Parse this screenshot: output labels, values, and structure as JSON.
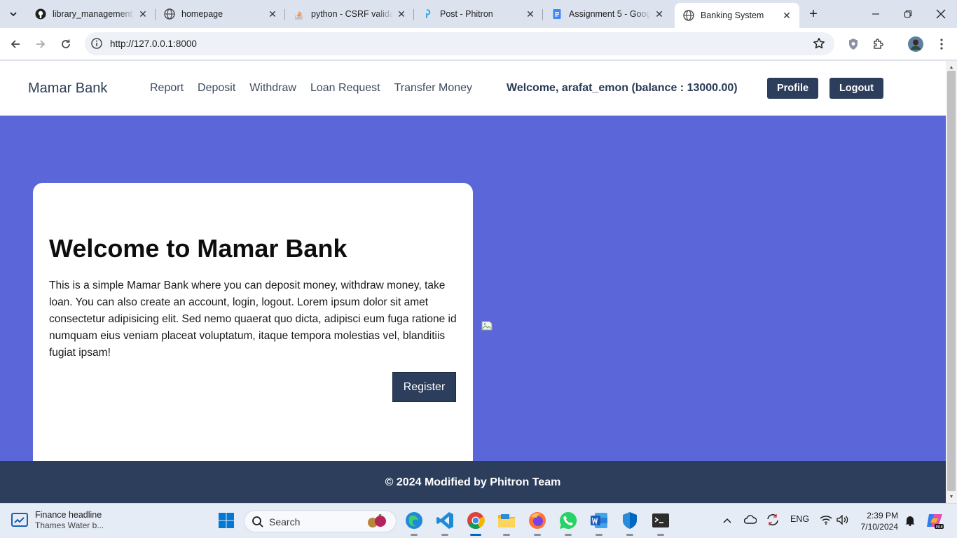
{
  "browser": {
    "tabs": [
      {
        "title": "library_management_",
        "icon": "github-icon"
      },
      {
        "title": "homepage",
        "icon": "globe-icon"
      },
      {
        "title": "python - CSRF validat",
        "icon": "stackoverflow-icon"
      },
      {
        "title": "Post - Phitron",
        "icon": "phitron-icon"
      },
      {
        "title": "Assignment 5 - Goog",
        "icon": "google-docs-icon"
      },
      {
        "title": "Banking System",
        "icon": "globe-icon",
        "active": true
      }
    ],
    "url": "http://127.0.0.1:8000"
  },
  "site": {
    "brand": "Mamar Bank",
    "nav": [
      "Report",
      "Deposit",
      "Withdraw",
      "Loan Request",
      "Transfer Money"
    ],
    "welcome": "Welcome, arafat_emon (balance : 13000.00)",
    "profile_label": "Profile",
    "logout_label": "Logout"
  },
  "hero": {
    "title": "Welcome to Mamar Bank",
    "text": "This is a simple Mamar Bank where you can deposit money, withdraw money, take loan. You can also create an account, login, logout. Lorem ipsum dolor sit amet consectetur adipisicing elit. Sed nemo quaerat quo dicta, adipisci eum fuga ratione id numquam eius veniam placeat voluptatum, itaque tempora molestias vel, blanditiis fugiat ipsam!",
    "register_label": "Register"
  },
  "footer": {
    "text": "© 2024 Modified by Phitron Team"
  },
  "taskbar": {
    "news_title": "Finance headline",
    "news_sub": "Thames Water b...",
    "search_label": "Search",
    "language": "ENG",
    "time": "2:39 PM",
    "date": "7/10/2024"
  },
  "colors": {
    "hero_bg": "#5b67d9",
    "dark_navy": "#2c3e5c",
    "tab_strip": "#dde3ee"
  }
}
